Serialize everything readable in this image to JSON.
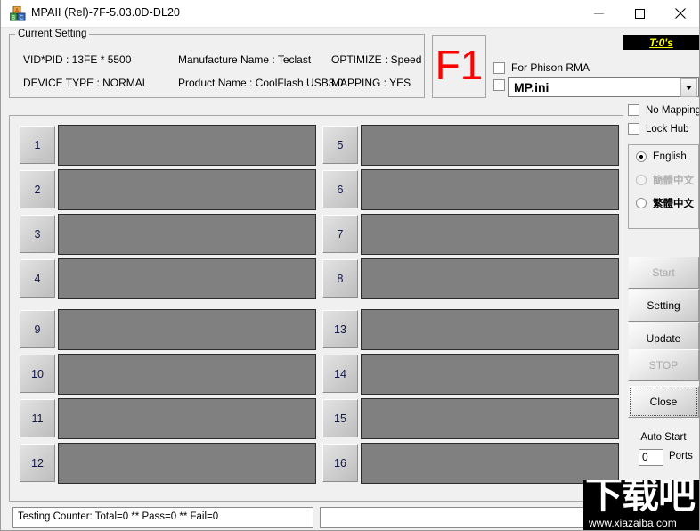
{
  "window": {
    "title": "MPAII (Rel)-7F-5.03.0D-DL20",
    "icon": "blocks-icon",
    "controls": {
      "minimize": "minimize-icon",
      "maximize": "maximize-icon",
      "close": "close-icon"
    }
  },
  "current_setting": {
    "legend": "Current Setting",
    "vid_pid": "VID*PID : 13FE * 5500",
    "device_type": "DEVICE TYPE : NORMAL",
    "manufacture_name": "Manufacture Name : Teclast",
    "product_name": "Product Name : CoolFlash USB3.0",
    "optimize": "OPTIMIZE : Speed",
    "mapping": "MAPPING : YES"
  },
  "f1_panel": {
    "label": "F1",
    "color": "#ff0000"
  },
  "timer_badge": {
    "text": "T:0's",
    "background": "#000000",
    "color": "#ffff00"
  },
  "options": {
    "phison_rma": {
      "label": "For Phison RMA",
      "checked": false
    },
    "ini_checkbox": {
      "checked": false
    },
    "ini_combo": {
      "value": "MP.ini",
      "arrow": "chevron-down-icon"
    },
    "no_mapping": {
      "label": "No Mapping",
      "checked": false
    },
    "lock_hub": {
      "label": "Lock Hub",
      "checked": false
    }
  },
  "language": {
    "items": [
      {
        "label": "English",
        "selected": true,
        "disabled": false
      },
      {
        "label": "簡體中文",
        "selected": false,
        "disabled": true
      },
      {
        "label": "繁體中文",
        "selected": false,
        "disabled": false
      }
    ]
  },
  "buttons": [
    {
      "label": "Start",
      "disabled": true,
      "focused": false
    },
    {
      "label": "Setting",
      "disabled": false,
      "focused": false
    },
    {
      "label": "Update",
      "disabled": false,
      "focused": false
    },
    {
      "label": "STOP",
      "disabled": true,
      "focused": false
    },
    {
      "label": "Close",
      "disabled": false,
      "focused": true
    }
  ],
  "auto_start": {
    "label": "Auto Start",
    "value": "0",
    "unit": "Ports"
  },
  "ports": {
    "left": [
      "1",
      "2",
      "3",
      "4",
      "9",
      "10",
      "11",
      "12"
    ],
    "right": [
      "5",
      "6",
      "7",
      "8",
      "13",
      "14",
      "15",
      "16"
    ],
    "bar_color": "#808080"
  },
  "status": {
    "left": "Testing Counter: Total=0 ** Pass=0 ** Fail=0",
    "right": ""
  },
  "watermark": {
    "cjk": "下载吧",
    "url": "www.xiazaiba.com"
  }
}
